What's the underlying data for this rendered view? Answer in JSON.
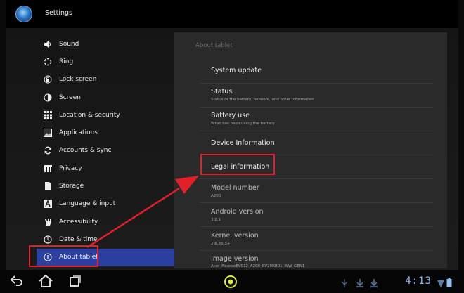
{
  "app": {
    "title": "Settings"
  },
  "sidebar": {
    "items": [
      {
        "label": "Sound",
        "icon": "sound-icon"
      },
      {
        "label": "Ring",
        "icon": "ring-icon"
      },
      {
        "label": "Lock screen",
        "icon": "lock-screen-icon"
      },
      {
        "label": "Screen",
        "icon": "screen-icon"
      },
      {
        "label": "Location & security",
        "icon": "location-security-icon"
      },
      {
        "label": "Applications",
        "icon": "applications-icon"
      },
      {
        "label": "Accounts & sync",
        "icon": "sync-icon"
      },
      {
        "label": "Privacy",
        "icon": "privacy-icon"
      },
      {
        "label": "Storage",
        "icon": "storage-icon"
      },
      {
        "label": "Language & input",
        "icon": "language-icon"
      },
      {
        "label": "Accessibility",
        "icon": "accessibility-icon"
      },
      {
        "label": "Date & time",
        "icon": "clock-icon"
      },
      {
        "label": "About tablet",
        "icon": "info-icon",
        "selected": true
      }
    ]
  },
  "detail": {
    "header": "About tablet",
    "rows": [
      {
        "title": "System update",
        "subtitle": ""
      },
      {
        "title": "Status",
        "subtitle": "Status of the battery, network, and other information"
      },
      {
        "title": "Battery use",
        "subtitle": "What has been using the battery"
      },
      {
        "title": "Device Information",
        "subtitle": ""
      },
      {
        "title": "Legal information",
        "subtitle": ""
      },
      {
        "title": "Model number",
        "subtitle": "A200"
      },
      {
        "title": "Android version",
        "subtitle": "3.2.1"
      },
      {
        "title": "Kernel version",
        "subtitle": "2.6.36.3+"
      },
      {
        "title": "Image version",
        "subtitle": "Acer_PicassoEV032_A200_RV20RB01_WW_GEN1"
      }
    ]
  },
  "statusbar": {
    "time": "4:13"
  },
  "colors": {
    "highlight": "#e2202a",
    "selected_bg": "#2a3f9e",
    "clock": "#8fbff0"
  }
}
